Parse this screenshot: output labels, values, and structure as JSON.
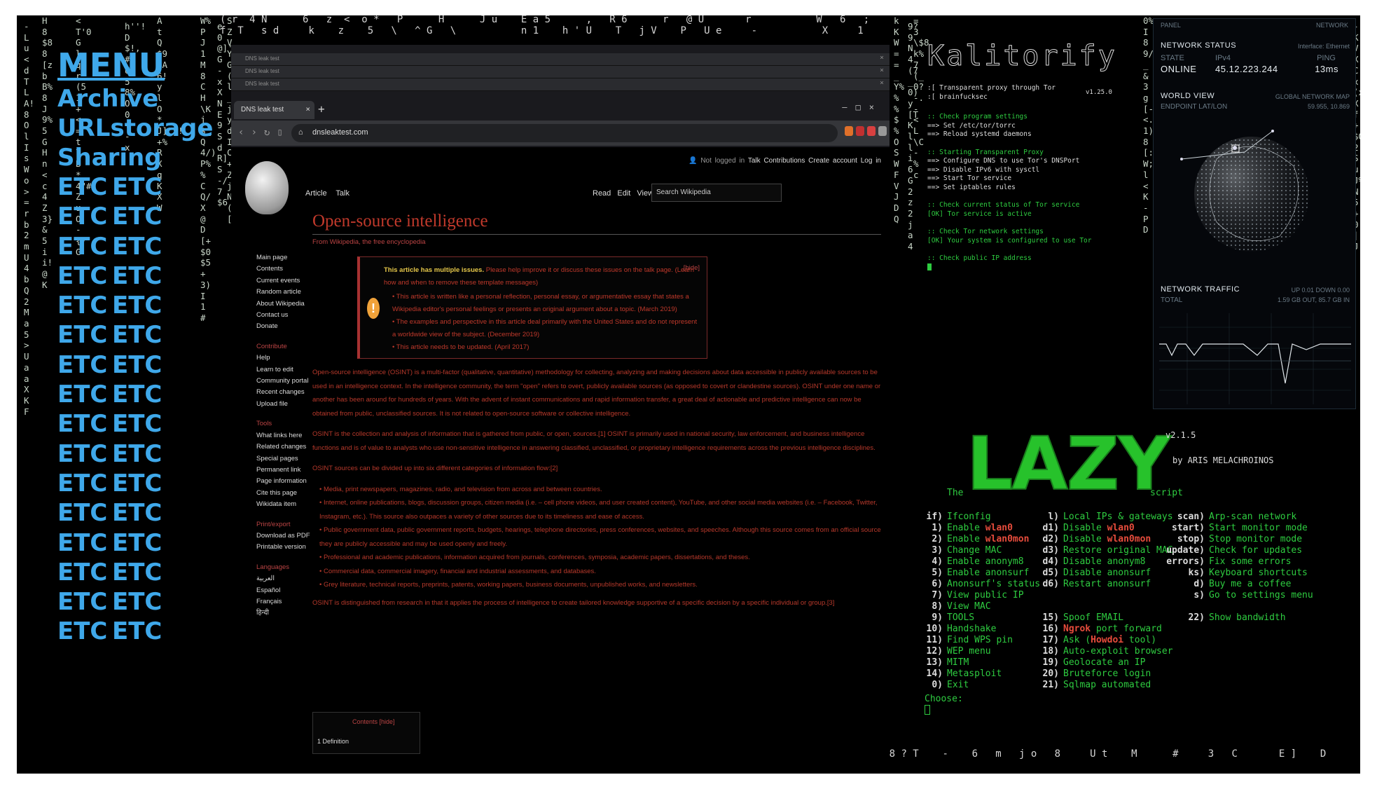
{
  "menu": {
    "title": "MENU",
    "items": [
      "Archive",
      "URLstorage",
      "Sharing"
    ],
    "etc_label": "ETC",
    "etc_rows": 16
  },
  "browser": {
    "tabs": [
      "DNS leak test",
      "DNS leak test",
      "DNS leak test"
    ],
    "active_tab": "DNS leak test",
    "url": "dnsleaktest.com",
    "personal": {
      "not_logged_in": "Not logged in",
      "talk": "Talk",
      "contributions": "Contributions",
      "create_account": "Create account",
      "log_in": "Log in"
    },
    "tabs_left": [
      "Article",
      "Talk"
    ],
    "tabs_right": [
      "Read",
      "Edit",
      "View history"
    ],
    "search_placeholder": "Search Wikipedia",
    "sidenav": {
      "main": [
        "Main page",
        "Contents",
        "Current events",
        "Random article",
        "About Wikipedia",
        "Contact us",
        "Donate"
      ],
      "contribute_header": "Contribute",
      "contribute": [
        "Help",
        "Learn to edit",
        "Community portal",
        "Recent changes",
        "Upload file"
      ],
      "tools_header": "Tools",
      "tools": [
        "What links here",
        "Related changes",
        "Special pages",
        "Permanent link",
        "Page information",
        "Cite this page",
        "Wikidata item"
      ],
      "print_header": "Print/export",
      "print": [
        "Download as PDF",
        "Printable version"
      ],
      "languages_header": "Languages",
      "languages": [
        "العربية",
        "Español",
        "Français",
        "हिन्दी"
      ]
    },
    "article": {
      "title": "Open-source intelligence",
      "from": "From Wikipedia, the free encyclopedia",
      "ambox": {
        "hide": "[hide]",
        "line1_bold": "This article has multiple issues.",
        "line1_rest": "Please help improve it or discuss these issues on the talk page. (Learn how and when to remove these template messages)",
        "issues": [
          "This article is written like a personal reflection, personal essay, or argumentative essay that states a Wikipedia editor's personal feelings or presents an original argument about a topic. (March 2019)",
          "The examples and perspective in this article deal primarily with the United States and do not represent a worldwide view of the subject. (December 2019)",
          "This article needs to be updated. (April 2017)"
        ]
      },
      "p1": "Open-source intelligence (OSINT) is a multi-factor (qualitative, quantitative) methodology for collecting, analyzing and making decisions about data accessible in publicly available sources to be used in an intelligence context. In the intelligence community, the term \"open\" refers to overt, publicly available sources (as opposed to covert or clandestine sources). OSINT under one name or another has been around for hundreds of years. With the advent of instant communications and rapid information transfer, a great deal of actionable and predictive intelligence can now be obtained from public, unclassified sources. It is not related to open-source software or collective intelligence.",
      "p2": "OSINT is the collection and analysis of information that is gathered from public, or open, sources.[1] OSINT is primarily used in national security, law enforcement, and business intelligence functions and is of value to analysts who use non-sensitive intelligence in answering classified, unclassified, or proprietary intelligence requirements across the previous intelligence disciplines.",
      "p3": "OSINT sources can be divided up into six different categories of information flow:[2]",
      "bullets": [
        "Media, print newspapers, magazines, radio, and television from across and between countries.",
        "Internet, online publications, blogs, discussion groups, citizen media (i.e. – cell phone videos, and user created content), YouTube, and other social media websites (i.e. – Facebook, Twitter, Instagram, etc.). This source also outpaces a variety of other sources due to its timeliness and ease of access.",
        "Public government data, public government reports, budgets, hearings, telephone directories, press conferences, websites, and speeches. Although this source comes from an official source they are publicly accessible and may be used openly and freely.",
        "Professional and academic publications, information acquired from journals, conferences, symposia, academic papers, dissertations, and theses.",
        "Commercial data, commercial imagery, financial and industrial assessments, and databases.",
        "Grey literature, technical reports, preprints, patents, working papers, business documents, unpublished works, and newsletters."
      ],
      "p4": "OSINT is distinguished from research in that it applies the process of intelligence to create tailored knowledge supportive of a specific decision by a specific individual or group.[3]",
      "toc_header": "Contents [hide]",
      "toc_item": "1  Definition"
    }
  },
  "tor": {
    "version": "v1.25.0",
    "header": [
      ":[ Transparent proxy through Tor",
      ":[ brainfucksec"
    ],
    "lines": [
      ":: Check program settings",
      "==> Set /etc/tor/torrc",
      "==> Reload systemd daemons",
      "",
      ":: Starting Transparent Proxy",
      "==> Configure DNS to use Tor's DNSPort",
      "==> Disable IPv6 with sysctl",
      "==> Start Tor service",
      "==> Set iptables rules",
      "",
      ":: Check current status of Tor service",
      "[OK] Tor service is active",
      "",
      ":: Check Tor network settings",
      "[OK] Your system is configured to use Tor",
      "",
      ":: Check public IP address"
    ]
  },
  "panel": {
    "panel_label": "PANEL",
    "network_label": "NETWORK",
    "status_title": "NETWORK STATUS",
    "interface": "Interface: Ethernet",
    "state_label": "STATE",
    "state_value": "ONLINE",
    "ipv4_label": "IPv4",
    "ipv4_value": "45.12.223.244",
    "ping_label": "PING",
    "ping_value": "13ms",
    "world_title": "WORLD VIEW",
    "world_sub": "GLOBAL NETWORK MAP",
    "endpoint_label": "ENDPOINT LAT/LON",
    "endpoint_value": "59.955, 10.869",
    "traffic_title": "NETWORK TRAFFIC",
    "traffic_updown": "UP 0.01  DOWN 0.00",
    "total_label": "TOTAL",
    "total_value": "1.59 GB OUT, 85.7 GB IN"
  },
  "lazy": {
    "logo": "LAZY",
    "version": "v2.1.5",
    "by": "by ARIS MELACHROINOS",
    "the": "The",
    "script": "script",
    "col1": [
      {
        "k": "if)",
        "t": "Ifconfig"
      },
      {
        "k": "1)",
        "t": "Enable ",
        "h": "wlan0"
      },
      {
        "k": "2)",
        "t": "Enable ",
        "h": "wlan0mon"
      },
      {
        "k": "3)",
        "t": "Change MAC"
      },
      {
        "k": "4)",
        "t": "Enable anonym8"
      },
      {
        "k": "5)",
        "t": "Enable anonsurf"
      },
      {
        "k": "6)",
        "t": "Anonsurf's status"
      },
      {
        "k": "7)",
        "t": "View public IP"
      },
      {
        "k": "8)",
        "t": "View MAC"
      },
      {
        "k": "9)",
        "t": "TOOLS"
      },
      {
        "k": "10)",
        "t": "Handshake"
      },
      {
        "k": "11)",
        "t": "Find WPS pin"
      },
      {
        "k": "12)",
        "t": "WEP menu"
      },
      {
        "k": "13)",
        "t": "MITM"
      },
      {
        "k": "14)",
        "t": "Metasploit"
      },
      {
        "k": "0)",
        "t": "Exit"
      }
    ],
    "col2": [
      {
        "k": "l)",
        "t": "Local IPs & gateways"
      },
      {
        "k": "d1)",
        "t": "Disable ",
        "h": "wlan0"
      },
      {
        "k": "d2)",
        "t": "Disable ",
        "h": "wlan0mon"
      },
      {
        "k": "d3)",
        "t": "Restore original MAC"
      },
      {
        "k": "d4)",
        "t": "Disable anonym8"
      },
      {
        "k": "d5)",
        "t": "Disable anonsurf"
      },
      {
        "k": "d6)",
        "t": "Restart anonsurf"
      },
      {
        "k": "",
        "t": ""
      },
      {
        "k": "",
        "t": ""
      },
      {
        "k": "15)",
        "t": "Spoof EMAIL"
      },
      {
        "k": "16)",
        "t": " port forward",
        "h0": "Ngrok"
      },
      {
        "k": "17)",
        "t": "Ask (",
        "h": "Howdoi",
        "t2": " tool)"
      },
      {
        "k": "18)",
        "t": "Auto-exploit browser"
      },
      {
        "k": "19)",
        "t": "Geolocate an IP"
      },
      {
        "k": "20)",
        "t": "Bruteforce login"
      },
      {
        "k": "21)",
        "t": "Sqlmap automated"
      }
    ],
    "col3": [
      {
        "k": "scan)",
        "t": "Arp-scan network"
      },
      {
        "k": "start)",
        "t": "Start monitor mode"
      },
      {
        "k": "stop)",
        "t": "Stop monitor mode"
      },
      {
        "k": "update)",
        "t": "Check for updates"
      },
      {
        "k": "errors)",
        "t": "Fix some errors"
      },
      {
        "k": "ks)",
        "t": "Keyboard shortcuts"
      },
      {
        "k": "d)",
        "t": "Buy me a coffee"
      },
      {
        "k": "s)",
        "t": "Go to settings menu"
      },
      {
        "k": "",
        "t": ""
      },
      {
        "k": "22)",
        "t": "Show bandwidth"
      }
    ],
    "choose": "Choose:"
  },
  "rain": {
    "top_row": "( r  4 N      6   z  <  o *   P      H      J u    E a 5      ,   R 6      r   @ U       r           W   6   ;",
    "top_row2": "f  T   s d     k    z    5   \\   ^ G   \\           n 1    h ' U    T   j V    P   U e     -           X     1",
    "bottom_row": "$       a 2 1              r a    & [ P K * \\        y            U  5 H     2      _      T q   ?        1    8 ? T    -    6   m   j o   8     U t    M      #     3   C       E ]    D",
    "columns": [
      {
        "text": "-Lu<dTLA!8OlIsWo>=rb2mU4bQ2Ma5>UaaXKF",
        "c": ""
      },
      {
        "text": "H8$88[zbB%8J9%5GHn<c4Z3}&5ii!@K",
        "c": ""
      },
      {
        "text": "<T'0Glqr(51+<=t7B*4\"#ZuO-{7G",
        "c": ""
      },
      {
        "text": "h''!D$!,#:U58%O?0+-x",
        "c": ""
      },
      {
        "text": "AtQ$9$A6!ylO*J]\"y!+%RXqKXW",
        "c": ""
      },
      {
        "text": "W%PJ1M8CH\\Kj$_Q4/)P%%CQ/X@D[+$0$5+3)I1#",
        "c": ""
      },
      {
        "text": "e0@]'NG-xXNE9SdR]S-/7$6",
        "c": ""
      },
      {
        "text": "SZVYG(Jl_:j)yd/I]C+ZjN!(y[!",
        "c": ""
      },
      {
        "text": "kKW==_Y%%%$%OSWFVJDQ",
        "c": ""
      },
      {
        "text": "9?9N4(7_0)y[TKlli6G2z2ja4",
        "c": ""
      },
      {
        "text": "0%I89/_&3g[-<.1)8[:W;l<K-PD",
        "c": ""
      },
      {
        "text": "=3\\$8k%7(_0?-.-<L\\C-%c",
        "c": ""
      },
      {
        "text": "-KV.XCx(xXf+$Q2SuJ%N5+0|J",
        "c": ""
      }
    ]
  }
}
